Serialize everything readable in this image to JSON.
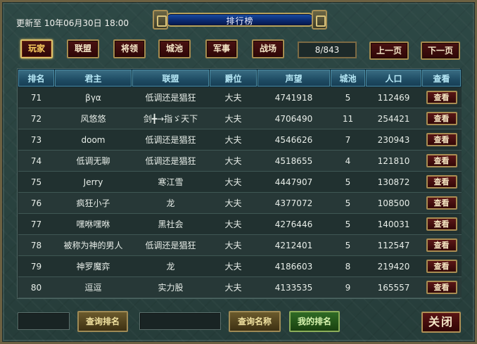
{
  "header": {
    "update_label": "更新至 10年06月30日 18:00",
    "title": "排行榜"
  },
  "tabs": [
    {
      "label": "玩家",
      "active": true
    },
    {
      "label": "联盟",
      "active": false
    },
    {
      "label": "将领",
      "active": false
    },
    {
      "label": "城池",
      "active": false
    },
    {
      "label": "军事",
      "active": false
    },
    {
      "label": "战场",
      "active": false
    }
  ],
  "pager": {
    "page_display": "8/843",
    "prev_label": "上一页",
    "next_label": "下一页"
  },
  "table": {
    "columns": [
      "排名",
      "君主",
      "联盟",
      "爵位",
      "声望",
      "城池",
      "人口",
      "查看"
    ],
    "view_label": "查看",
    "rows": [
      {
        "rank": "71",
        "lord": "βγα",
        "alliance": "低调还是猖狂",
        "title": "大夫",
        "prestige": "4741918",
        "cities": "5",
        "population": "112469"
      },
      {
        "rank": "72",
        "lord": "风悠悠",
        "alliance": "剑╋→指ゞ天下",
        "title": "大夫",
        "prestige": "4706490",
        "cities": "11",
        "population": "254421"
      },
      {
        "rank": "73",
        "lord": "doom",
        "alliance": "低调还是猖狂",
        "title": "大夫",
        "prestige": "4546626",
        "cities": "7",
        "population": "230943"
      },
      {
        "rank": "74",
        "lord": "低调无聊",
        "alliance": "低调还是猖狂",
        "title": "大夫",
        "prestige": "4518655",
        "cities": "4",
        "population": "121810"
      },
      {
        "rank": "75",
        "lord": "Jerry",
        "alliance": "寒江雪",
        "title": "大夫",
        "prestige": "4447907",
        "cities": "5",
        "population": "130872"
      },
      {
        "rank": "76",
        "lord": "疯狂小子",
        "alliance": "龙",
        "title": "大夫",
        "prestige": "4377072",
        "cities": "5",
        "population": "108500"
      },
      {
        "rank": "77",
        "lord": "嘿咻嘿咻",
        "alliance": "黑社会",
        "title": "大夫",
        "prestige": "4276446",
        "cities": "5",
        "population": "140031"
      },
      {
        "rank": "78",
        "lord": "被称为神的男人",
        "alliance": "低调还是猖狂",
        "title": "大夫",
        "prestige": "4212401",
        "cities": "5",
        "population": "112547"
      },
      {
        "rank": "79",
        "lord": "神罗魔弈",
        "alliance": "龙",
        "title": "大夫",
        "prestige": "4186603",
        "cities": "8",
        "population": "219420"
      },
      {
        "rank": "80",
        "lord": "逗逗",
        "alliance": "实力股",
        "title": "大夫",
        "prestige": "4133535",
        "cities": "9",
        "population": "165557"
      }
    ]
  },
  "footer": {
    "rank_input_value": "",
    "query_rank_label": "查询排名",
    "name_input_value": "",
    "query_name_label": "查询名称",
    "my_rank_label": "我的排名",
    "close_label": "关闭"
  }
}
